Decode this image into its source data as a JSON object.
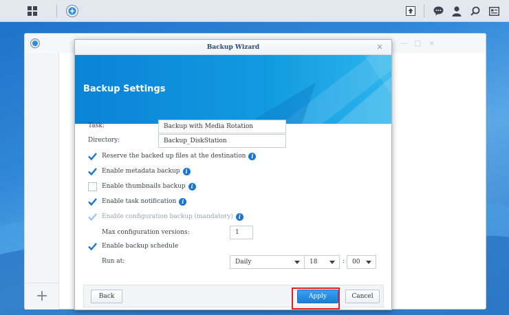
{
  "taskbar": {
    "icons": [
      "main-menu-icon",
      "backup-app-icon",
      "upload-icon",
      "chat-icon",
      "user-icon",
      "search-icon",
      "widgets-icon"
    ]
  },
  "background_window": {
    "controls": {
      "minimize": "—",
      "maximize": "□",
      "close": "×"
    },
    "add_label": "+"
  },
  "dialog": {
    "title": "Backup Wizard",
    "close_label": "×",
    "header_title": "Backup Settings",
    "task": {
      "label": "Task:",
      "value": "Backup with Media Rotation"
    },
    "directory": {
      "label": "Directory:",
      "value": "Backup_DiskStation"
    },
    "options": [
      {
        "label": "Reserve the backed up files at the destination",
        "checked": true,
        "disabled": false,
        "info": true
      },
      {
        "label": "Enable metadata backup",
        "checked": true,
        "disabled": false,
        "info": true
      },
      {
        "label": "Enable thumbnails backup",
        "checked": false,
        "disabled": false,
        "info": true
      },
      {
        "label": "Enable task notification",
        "checked": true,
        "disabled": false,
        "info": true
      },
      {
        "label": "Enable configuration backup (mandatory)",
        "checked": true,
        "disabled": true,
        "info": true
      }
    ],
    "max_versions": {
      "label": "Max configuration versions:",
      "value": "1"
    },
    "schedule": {
      "label": "Enable backup schedule",
      "checked": true
    },
    "run_at": {
      "label": "Run at:",
      "frequency": "Daily",
      "hour": "18",
      "separator": ":",
      "minute": "00"
    },
    "buttons": {
      "back": "Back",
      "apply": "Apply",
      "cancel": "Cancel"
    }
  },
  "colors": {
    "accent": "#1a74d2",
    "check": "#1a74d2",
    "highlight": "#e32020"
  }
}
